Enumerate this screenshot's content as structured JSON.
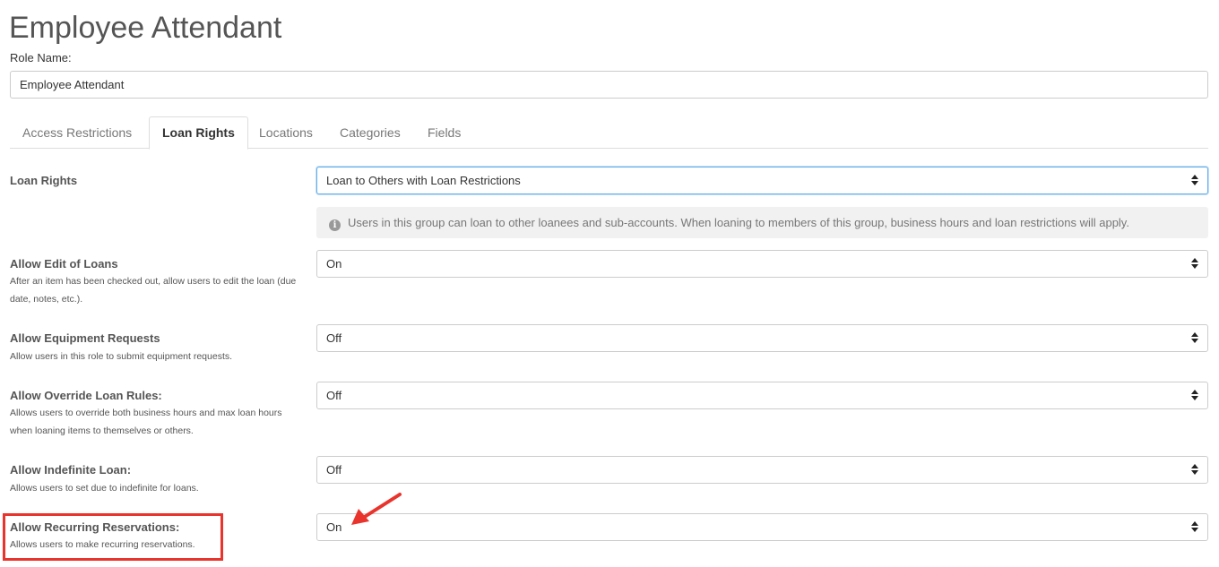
{
  "page": {
    "title": "Employee Attendant"
  },
  "role": {
    "label": "Role Name:",
    "value": "Employee Attendant"
  },
  "tabs": [
    {
      "label": "Access Restrictions",
      "active": false
    },
    {
      "label": "Loan Rights",
      "active": true
    },
    {
      "label": "Locations",
      "active": false
    },
    {
      "label": "Categories",
      "active": false
    },
    {
      "label": "Fields",
      "active": false
    }
  ],
  "loan_rights": {
    "label": "Loan Rights",
    "value": "Loan to Others with Loan Restrictions",
    "info": "Users in this group can loan to other loanees and sub-accounts. When loaning to members of this group, business hours and loan restrictions will apply."
  },
  "settings": [
    {
      "label": "Allow Edit of Loans",
      "help": "After an item has been checked out, allow users to edit the loan (due date, notes, etc.).",
      "value": "On"
    },
    {
      "label": "Allow Equipment Requests",
      "help": "Allow users in this role to submit equipment requests.",
      "value": "Off"
    },
    {
      "label": "Allow Override Loan Rules:",
      "help": "Allows users to override both business hours and max loan hours when loaning items to themselves or others.",
      "value": "Off"
    },
    {
      "label": "Allow Indefinite Loan:",
      "help": "Allows users to set due to indefinite for loans.",
      "value": "Off"
    },
    {
      "label": "Allow Recurring Reservations:",
      "help": "Allows users to make recurring reservations.",
      "value": "On"
    }
  ],
  "icons": {
    "info": "info-circle-icon",
    "select_caret": "chevron-up-down-icon",
    "annotation": "arrow-icon"
  },
  "colors": {
    "annotation": "#e8342c",
    "focus": "#66afe9"
  }
}
